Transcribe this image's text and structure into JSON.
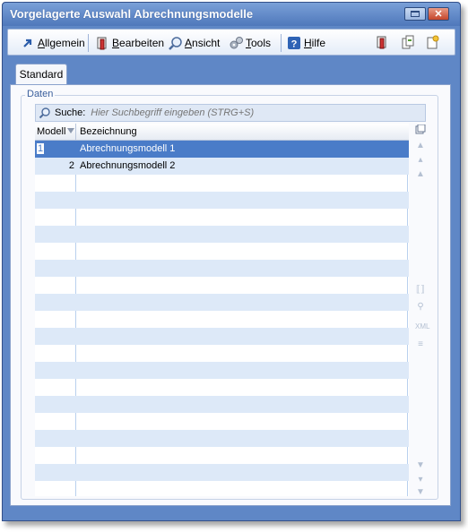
{
  "window": {
    "title": "Vorgelagerte Auswahl Abrechnungsmodelle",
    "close_glyph": "✕"
  },
  "toolbar": {
    "items": [
      {
        "label_pre": "",
        "label_ul": "A",
        "label_post": "llgemein",
        "icon": "arrow-up-right-icon"
      },
      {
        "label_pre": "",
        "label_ul": "B",
        "label_post": "earbeiten",
        "icon": "edit-icon"
      },
      {
        "label_pre": "",
        "label_ul": "A",
        "label_post": "nsicht",
        "icon": "view-magnifier-icon"
      },
      {
        "label_pre": "",
        "label_ul": "T",
        "label_post": "ools",
        "icon": "gears-icon"
      },
      {
        "label_pre": "",
        "label_ul": "H",
        "label_post": "ilfe",
        "icon": "help-icon"
      }
    ],
    "right_icons": [
      "edit-doc-icon",
      "copy-doc-icon",
      "new-doc-icon"
    ]
  },
  "tabs": [
    {
      "label": "Standard",
      "active": true
    }
  ],
  "group": {
    "label": "Daten"
  },
  "search": {
    "label": "Suche:",
    "placeholder": "Hier Suchbegriff eingeben (STRG+S)",
    "value": ""
  },
  "grid": {
    "columns": [
      "Modell",
      "Bezeichnung"
    ],
    "rows": [
      {
        "id": "1",
        "name": "Abrechnungsmodell 1",
        "selected": true
      },
      {
        "id": "2",
        "name": "Abrechnungsmodell 2",
        "selected": false
      }
    ]
  },
  "colors": {
    "selection": "#4a7cc8",
    "alt_row": "#dde9f8",
    "title_bar": "#5f87c6"
  }
}
